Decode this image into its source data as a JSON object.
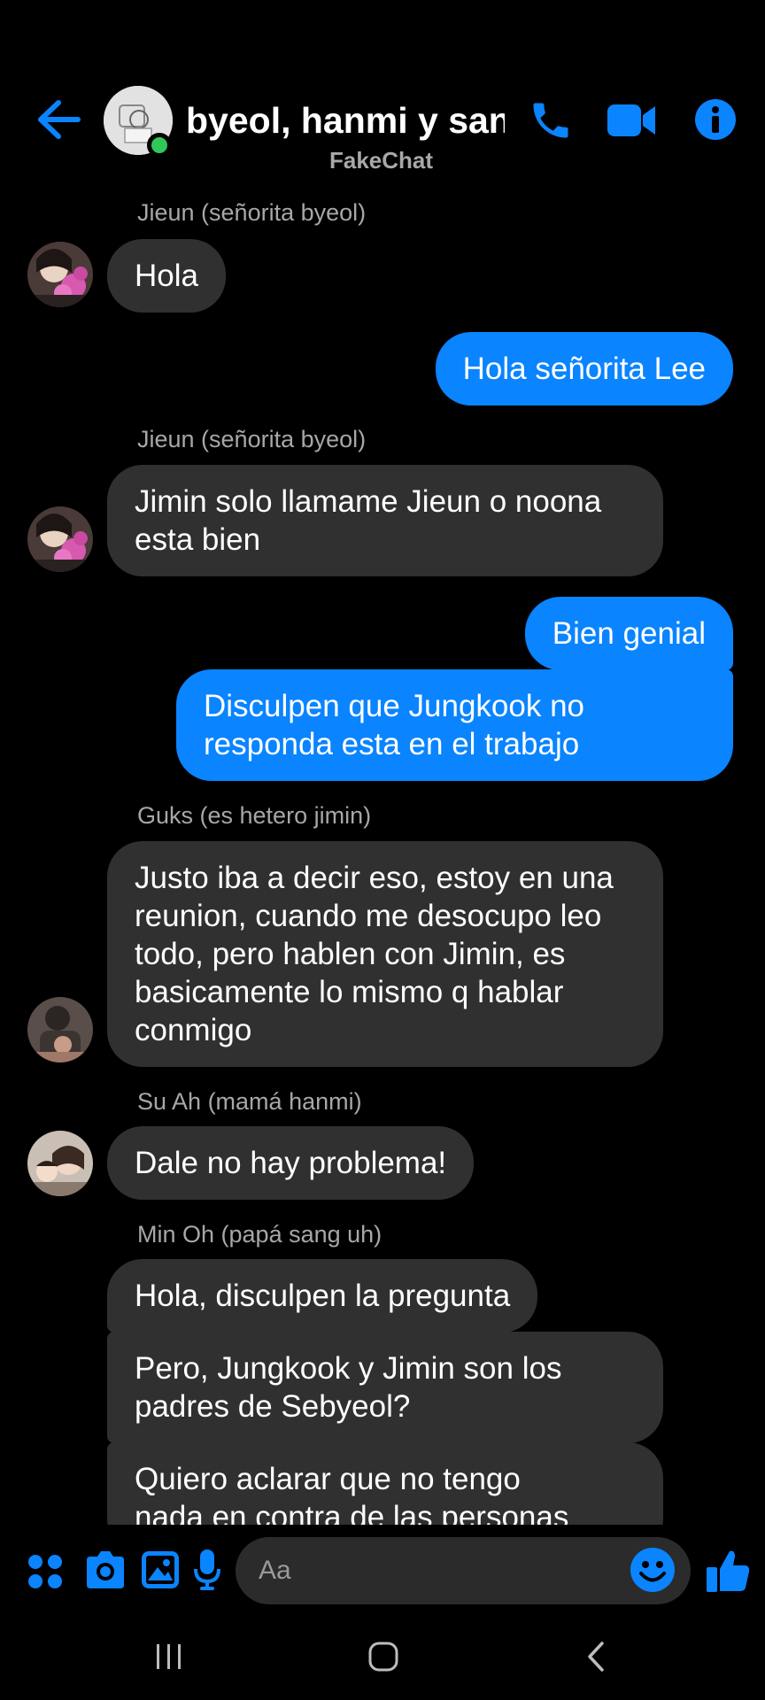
{
  "header": {
    "title": "byeol, hanmi y san…",
    "subtitle": "FakeChat",
    "icons": [
      "back-arrow-icon",
      "phone-icon",
      "video-camera-icon",
      "info-icon"
    ],
    "accent_color": "#0a84ff"
  },
  "messages": [
    {
      "sender": "Jieun (señorita byeol)",
      "text": "Hola",
      "direction": "incoming"
    },
    {
      "text": "Hola  señorita Lee",
      "direction": "outgoing"
    },
    {
      "sender": "Jieun (señorita byeol)",
      "text": "Jimin solo llamame Jieun o noona\nesta bien",
      "direction": "incoming"
    },
    {
      "text": "Bien genial",
      "direction": "outgoing"
    },
    {
      "text": "Disculpen que Jungkook no\nresponda esta en el trabajo",
      "direction": "outgoing"
    },
    {
      "sender": "Guks (es hetero jimin)",
      "text": "Justo iba a decir eso, estoy en una\nreunion, cuando me desocupo leo\ntodo, pero hablen con Jimin, es\nbasicamente lo mismo q hablar\nconmigo",
      "direction": "incoming"
    },
    {
      "sender": "Su Ah (mamá hanmi)",
      "text": "Dale no hay problema!",
      "direction": "incoming"
    },
    {
      "sender": "Min Oh (papá sang uh)",
      "text": "Hola, disculpen la pregunta",
      "direction": "incoming"
    },
    {
      "text": "Pero, Jungkook y Jimin son los\npadres de Sebyeol?",
      "direction": "incoming"
    },
    {
      "text": "Quiero aclarar que no tengo\nnada en contra de las personas",
      "direction": "incoming"
    }
  ],
  "composer": {
    "placeholder": "Aa",
    "icons": [
      "apps-icon",
      "camera-icon",
      "gallery-icon",
      "microphone-icon",
      "emoji-icon",
      "thumbs-up-icon"
    ]
  },
  "navbar": {
    "icons": [
      "recent-apps-icon",
      "home-icon",
      "back-icon"
    ]
  }
}
